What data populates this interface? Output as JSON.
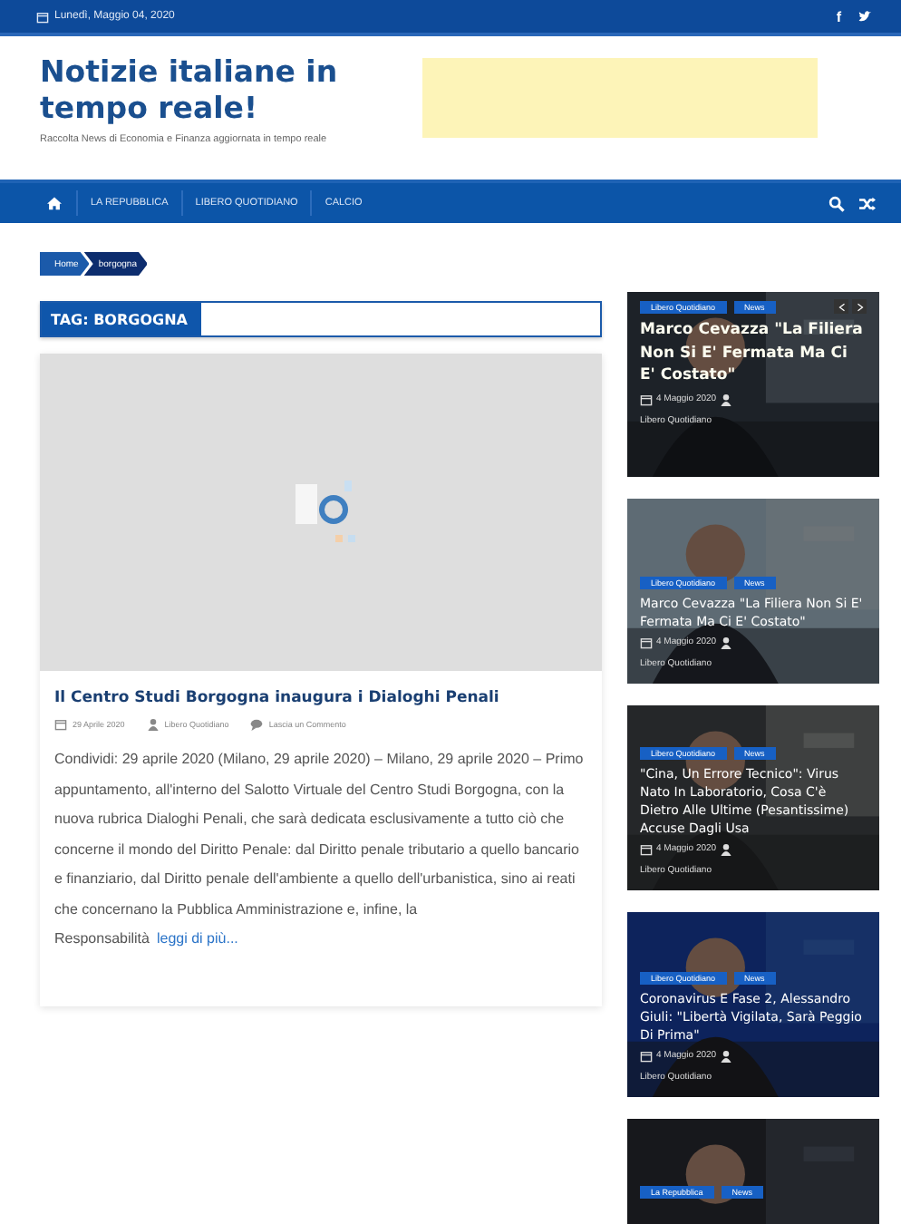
{
  "top_bar": {
    "date": "Lunedì, Maggio 04, 2020",
    "social": [
      {
        "kind": "facebook",
        "label": "f"
      },
      {
        "kind": "twitter"
      }
    ]
  },
  "header": {
    "site_title": "Notizie italiane in tempo reale!",
    "tagline": "Raccolta News di Economia e Finanza aggiornata in tempo reale"
  },
  "nav": {
    "items": [
      {
        "kind": "home"
      },
      {
        "kind": "link",
        "label": "LA REPUBBLICA"
      },
      {
        "kind": "link",
        "label": "LIBERO QUOTIDIANO"
      },
      {
        "kind": "link",
        "label": "CALCIO"
      }
    ]
  },
  "breadcrumb": [
    "Home",
    "borgogna"
  ],
  "archive_title": "TAG: BORGOGNA",
  "post": {
    "title": "Il Centro Studi Borgogna inaugura i Dialoghi Penali",
    "date": "29 Aprile 2020",
    "author": "Libero Quotidiano",
    "comments": "Lascia un Commento",
    "excerpt": "Condividi: 29 aprile 2020 (Milano, 29 aprile 2020) – Milano, 29 aprile 2020 – Primo appuntamento, all'interno del Salotto Virtuale del Centro Studi Borgogna, con la nuova rubrica Dialoghi Penali, che sarà dedicata esclusivamente a tutto ciò che concerne il mondo del Diritto Penale: dal Diritto penale tributario a quello bancario e finanziario, dal Diritto penale dell'ambiente a quello dell'urbanistica, sino ai reati che concernano la Pubblica Amministrazione e, infine, la Responsabilità",
    "read_more": "leggi di più..."
  },
  "sidebar": [
    {
      "kind": "slide",
      "tags": [
        "Libero Quotidiano",
        "News"
      ],
      "title": "Marco Cevazza \"La Filiera Non Si E' Fermata Ma Ci E' Costato\"",
      "date": "4 Maggio 2020",
      "author": "Libero Quotidiano"
    },
    {
      "kind": "post",
      "tags": [
        "Libero Quotidiano",
        "News"
      ],
      "title": "Marco Cevazza \"La Filiera Non Si E' Fermata Ma Ci E' Costato\"",
      "date": "4 Maggio 2020",
      "author": "Libero Quotidiano"
    },
    {
      "kind": "post",
      "tags": [
        "Libero Quotidiano",
        "News"
      ],
      "title": "\"Cina, Un Errore Tecnico\": Virus Nato In Laboratorio, Cosa C'è Dietro Alle Ultime (Pesantissime) Accuse Dagli Usa",
      "date": "4 Maggio 2020",
      "author": "Libero Quotidiano"
    },
    {
      "kind": "post",
      "tags": [
        "Libero Quotidiano",
        "News"
      ],
      "title": "Coronavirus E Fase 2, Alessandro Giuli: \"Libertà Vigilata, Sarà Peggio Di Prima\"",
      "date": "4 Maggio 2020",
      "author": "Libero Quotidiano"
    },
    {
      "kind": "cut",
      "tags": [
        "La Repubblica",
        "News"
      ]
    }
  ]
}
